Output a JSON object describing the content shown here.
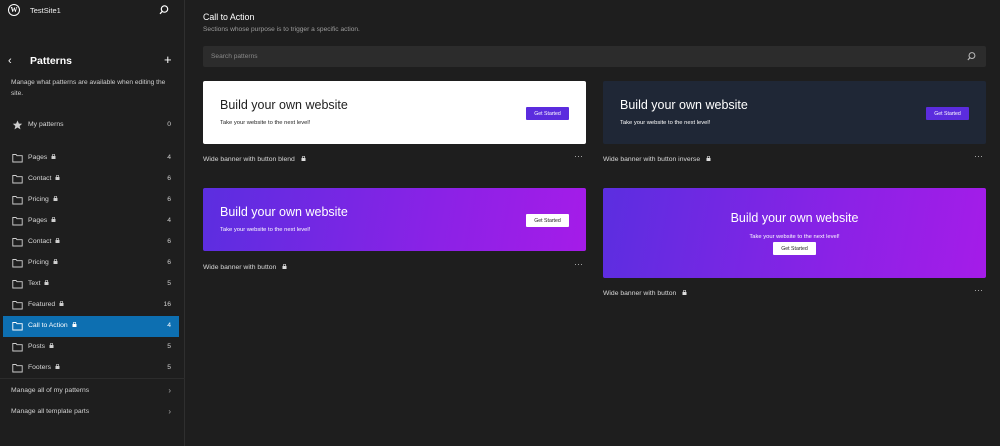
{
  "topbar": {
    "site_title": "TestSite1"
  },
  "sidebar": {
    "title": "Patterns",
    "description": "Manage what patterns are available when editing the site.",
    "my_patterns": {
      "label": "My patterns",
      "count": "0"
    },
    "items": [
      {
        "label": "Pages",
        "count": "4"
      },
      {
        "label": "Contact",
        "count": "6"
      },
      {
        "label": "Pricing",
        "count": "6"
      },
      {
        "label": "Pages",
        "count": "4"
      },
      {
        "label": "Contact",
        "count": "6"
      },
      {
        "label": "Pricing",
        "count": "6"
      },
      {
        "label": "Text",
        "count": "5"
      },
      {
        "label": "Featured",
        "count": "16"
      },
      {
        "label": "Call to Action",
        "count": "4"
      },
      {
        "label": "Posts",
        "count": "5"
      },
      {
        "label": "Footers",
        "count": "5"
      }
    ],
    "active_index": 8,
    "footer_links": [
      "Manage all of my patterns",
      "Manage all template parts"
    ]
  },
  "main": {
    "title": "Call to Action",
    "subtitle": "Sections whose purpose is to trigger a specific action.",
    "search_placeholder": "Search patterns",
    "cards": [
      {
        "heading": "Build your own website",
        "tagline": "Take your website to the next level!",
        "button": "Get Started",
        "caption": "Wide banner with button blend"
      },
      {
        "heading": "Build your own website",
        "tagline": "Take your website to the next level!",
        "button": "Get Started",
        "caption": "Wide banner with button inverse"
      },
      {
        "heading": "Build your own website",
        "tagline": "Take your website to the next level!",
        "button": "Get Started",
        "caption": "Wide banner with button"
      },
      {
        "heading": "Build your own website",
        "tagline": "Take your website to the next level!",
        "button": "Get Started",
        "caption": "Wide banner with button"
      }
    ],
    "more_label": "⋯"
  },
  "colors": {
    "accent_active": "#0d6fb1",
    "button_purple": "#5b2cde",
    "inverse_bg": "#1f2736",
    "gradient_start": "#5b2ee0",
    "gradient_end": "#a51ce8"
  }
}
